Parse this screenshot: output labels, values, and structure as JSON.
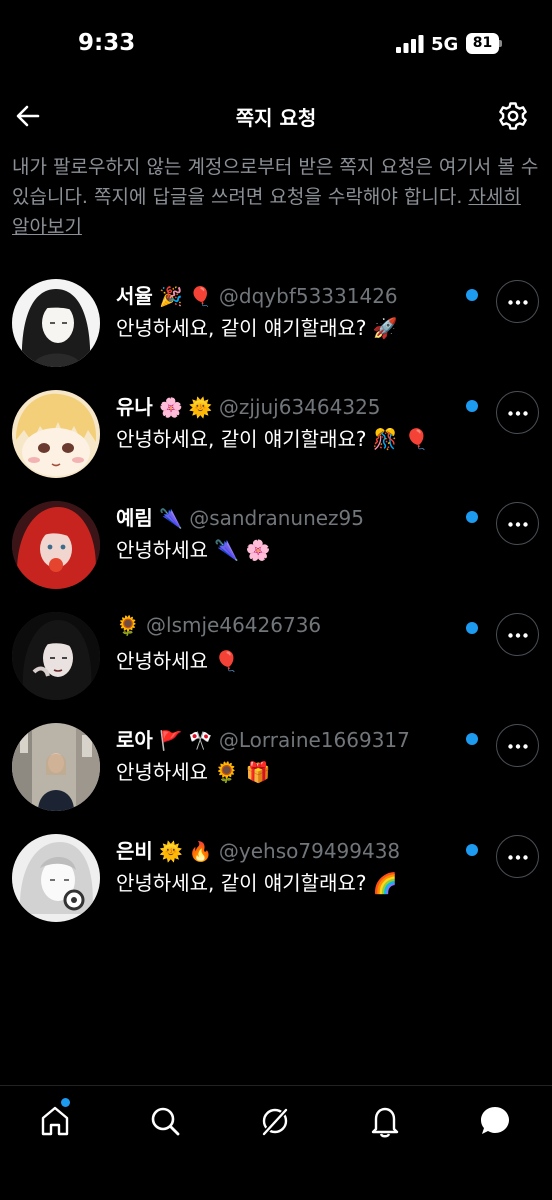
{
  "status_bar": {
    "time": "9:33",
    "network": "5G",
    "battery": "81"
  },
  "header": {
    "title": "쪽지 요청"
  },
  "description": {
    "text": "내가 팔로우하지 않는 계정으로부터 받은 쪽지 요청은 여기서 볼 수 있습니다. 쪽지에 답글을 쓰려면 요청을 수락해야 합니다. ",
    "link": "자세히 알아보기"
  },
  "requests": [
    {
      "name": "서율",
      "emoji": "🎉 🎈",
      "handle": "@dqybf53331426",
      "message": "안녕하세요, 같이 얘기할래요? 🚀"
    },
    {
      "name": "유나",
      "emoji": "🌸 🌞",
      "handle": "@zjjuj63464325",
      "message": "안녕하세요, 같이 얘기할래요? 🎊 🎈"
    },
    {
      "name": "예림",
      "emoji": "🌂",
      "handle": "@sandranunez95",
      "message": "안녕하세요 🌂 🌸"
    },
    {
      "name": "",
      "emoji": "🌻",
      "handle": "@lsmje46426736",
      "message": "안녕하세요 🎈"
    },
    {
      "name": "로아",
      "emoji": "🚩 🎌",
      "handle": "@Lorraine1669317",
      "message": "안녕하세요 🌻 🎁"
    },
    {
      "name": "은비",
      "emoji": "🌞 🔥",
      "handle": "@yehso79499438",
      "message": "안녕하세요, 같이 얘기할래요? 🌈"
    }
  ],
  "colors": {
    "accent": "#1d9bf0",
    "background": "#000000",
    "muted_text": "#71767b"
  },
  "icons": [
    "back-arrow-icon",
    "gear-icon",
    "more-icon",
    "home-icon",
    "search-icon",
    "grok-icon",
    "bell-icon",
    "messages-icon"
  ]
}
